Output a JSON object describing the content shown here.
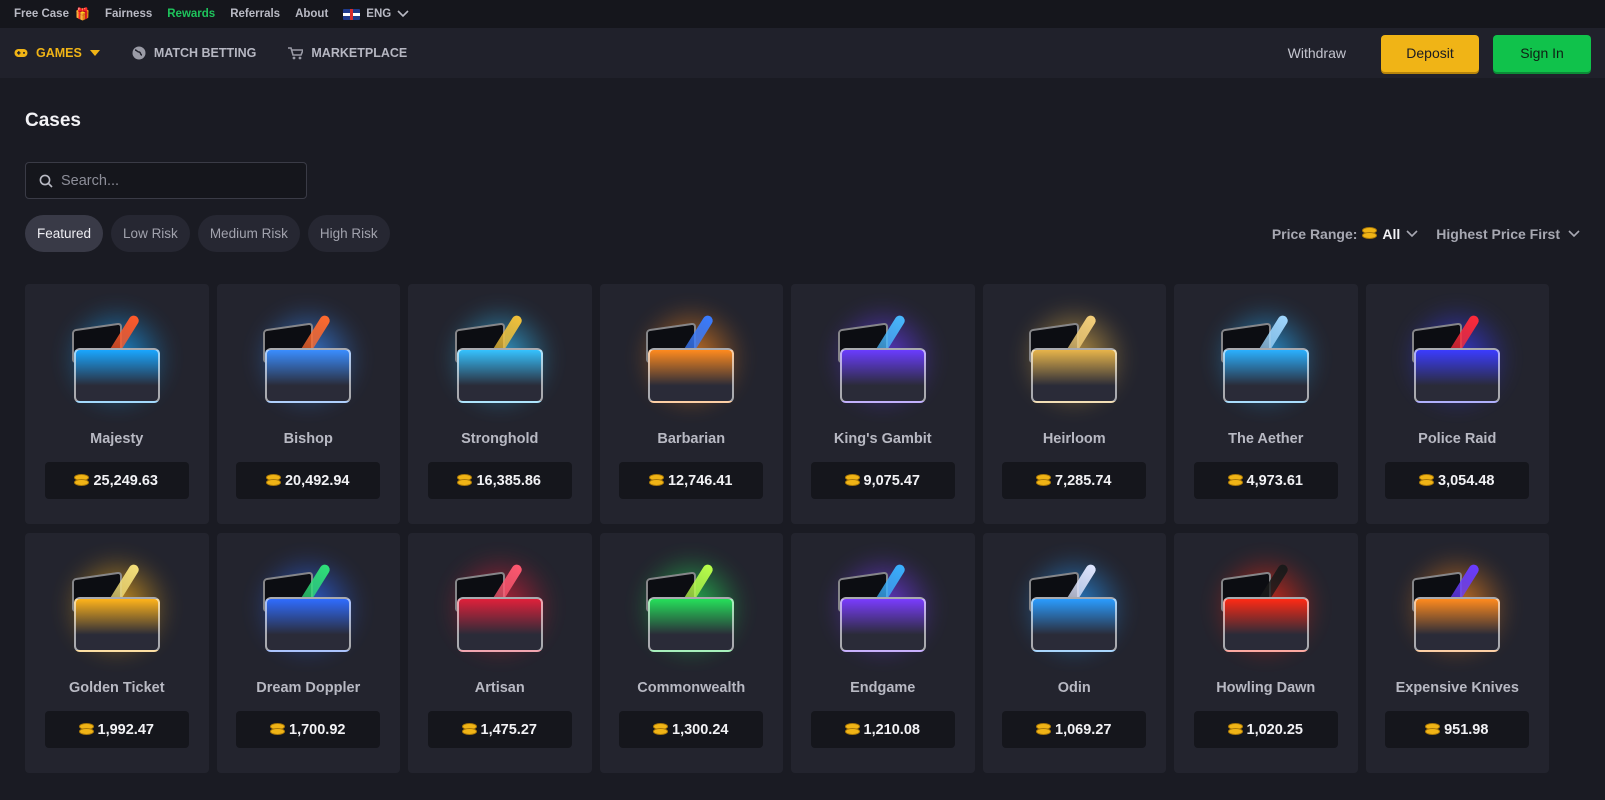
{
  "topbar": {
    "free_case": "Free Case",
    "fairness": "Fairness",
    "rewards": "Rewards",
    "referrals": "Referrals",
    "about": "About",
    "language": "ENG"
  },
  "nav": {
    "games": "GAMES",
    "match_betting": "MATCH BETTING",
    "marketplace": "MARKETPLACE",
    "withdraw": "Withdraw",
    "deposit": "Deposit",
    "sign_in": "Sign In"
  },
  "page": {
    "title": "Cases",
    "search_placeholder": "Search..."
  },
  "filters": {
    "tabs": [
      "Featured",
      "Low Risk",
      "Medium Risk",
      "High Risk"
    ],
    "active_tab": "Featured",
    "price_range_label": "Price Range:",
    "price_range_value": "All",
    "sort": "Highest Price First"
  },
  "colors": {
    "accent_gold": "#f0b416",
    "sign_in_green": "#10c24b",
    "rewards_green": "#1ec45c"
  },
  "cases": [
    {
      "name": "Majesty",
      "price": "25,249.63",
      "glow": "#19a6ff",
      "blade": "#ff5a2a"
    },
    {
      "name": "Bishop",
      "price": "20,492.94",
      "glow": "#3a8dff",
      "blade": "#ff6a2e"
    },
    {
      "name": "Stronghold",
      "price": "16,385.86",
      "glow": "#35c2ff",
      "blade": "#f2c23a"
    },
    {
      "name": "Barbarian",
      "price": "12,746.41",
      "glow": "#ff8a1e",
      "blade": "#3a7cff"
    },
    {
      "name": "King's Gambit",
      "price": "9,075.47",
      "glow": "#6a3cff",
      "blade": "#48b8ff"
    },
    {
      "name": "Heirloom",
      "price": "7,285.74",
      "glow": "#e7b44a",
      "blade": "#f5d07a"
    },
    {
      "name": "The Aether",
      "price": "4,973.61",
      "glow": "#2ab0ff",
      "blade": "#9fd7ff"
    },
    {
      "name": "Police Raid",
      "price": "3,054.48",
      "glow": "#3b3cff",
      "blade": "#ff2a3a"
    },
    {
      "name": "Golden Ticket",
      "price": "1,992.47",
      "glow": "#ffb31a",
      "blade": "#f5e07a"
    },
    {
      "name": "Dream Doppler",
      "price": "1,700.92",
      "glow": "#2f6cff",
      "blade": "#2ee07a"
    },
    {
      "name": "Artisan",
      "price": "1,475.27",
      "glow": "#e0203a",
      "blade": "#ff5870"
    },
    {
      "name": "Commonwealth",
      "price": "1,300.24",
      "glow": "#25e05a",
      "blade": "#b8ff4a"
    },
    {
      "name": "Endgame",
      "price": "1,210.08",
      "glow": "#7a3cff",
      "blade": "#3ab0ff"
    },
    {
      "name": "Odin",
      "price": "1,069.27",
      "glow": "#2a9cff",
      "blade": "#dfe6ff"
    },
    {
      "name": "Howling Dawn",
      "price": "1,020.25",
      "glow": "#ff2a14",
      "blade": "#1a1a1a"
    },
    {
      "name": "Expensive Knives",
      "price": "951.98",
      "glow": "#ff8a1e",
      "blade": "#6a3cff"
    }
  ]
}
